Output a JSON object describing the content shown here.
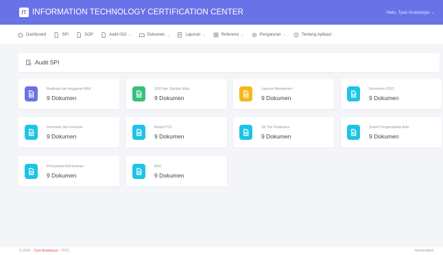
{
  "topbar": {
    "logo_text": "IT",
    "title": "INFORMATION TECHNOLOGY CERTIFICATION CENTER",
    "user_greeting": "Halo, Tyas Anastasya",
    "user_caret": "⌄"
  },
  "nav": [
    {
      "label": "Dashboard",
      "icon": "home-icon",
      "caret": false
    },
    {
      "label": "SPI",
      "icon": "doc-icon",
      "caret": false
    },
    {
      "label": "SOP",
      "icon": "doc-icon",
      "caret": false
    },
    {
      "label": "Audit ISO",
      "icon": "doc-icon",
      "caret": true
    },
    {
      "label": "Dokumen",
      "icon": "folder-icon",
      "caret": true
    },
    {
      "label": "Laporan",
      "icon": "report-icon",
      "caret": true
    },
    {
      "label": "Referensi",
      "icon": "grid-icon",
      "caret": true
    },
    {
      "label": "Pengaturan",
      "icon": "gear-icon",
      "caret": true
    },
    {
      "label": "Tentang Aplikasi",
      "icon": "info-icon",
      "caret": false
    }
  ],
  "page": {
    "title": "Audit SPI"
  },
  "cards": [
    {
      "label": "Realisasi dan Anggaran RKA",
      "count": "9 Dokumen",
      "color": "#6a72e8"
    },
    {
      "label": "SOP dan Standar Mutu",
      "count": "9 Dokumen",
      "color": "#35c27a"
    },
    {
      "label": "Laporan Manajemen",
      "count": "9 Dokumen",
      "color": "#f5b81c"
    },
    {
      "label": "Surveimen 2023",
      "count": "9 Dokumen",
      "color": "#1ec3e6"
    },
    {
      "label": "Inventaris dan Investasi",
      "count": "9 Dokumen",
      "color": "#1ec3e6"
    },
    {
      "label": "Modul ITCC",
      "count": "9 Dokumen",
      "color": "#1ec3e6"
    },
    {
      "label": "SK Tim Pelaksana",
      "count": "9 Dokumen",
      "color": "#1ec3e6"
    },
    {
      "label": "Sistem Pengendalian Adm",
      "count": "9 Dokumen",
      "color": "#1ec3e6"
    },
    {
      "label": "Pencatatan Administrasi",
      "count": "9 Dokumen",
      "color": "#1ec3e6"
    },
    {
      "label": "MoU",
      "count": "9 Dokumen",
      "color": "#1ec3e6"
    }
  ],
  "footer": {
    "prefix": "© 2024 -",
    "author": "Tyas Anastasya",
    "suffix": "- ITCC",
    "right": "Handcrafted"
  }
}
